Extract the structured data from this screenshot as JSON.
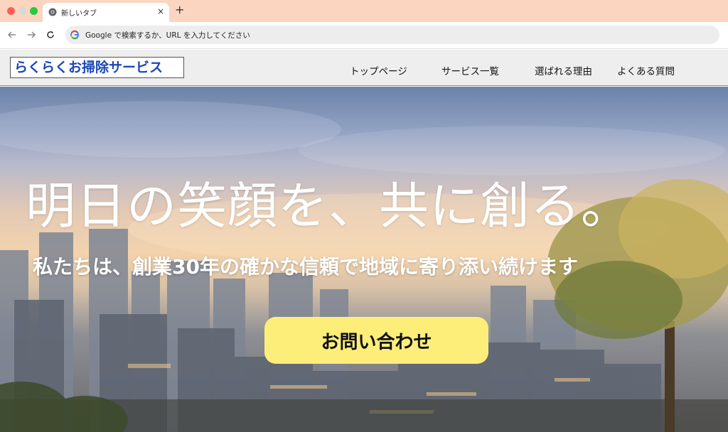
{
  "browser": {
    "tab_title": "新しいタブ",
    "tab_close": "×",
    "new_tab": "+",
    "address": "Google で検索するか、URL を入力してください"
  },
  "site": {
    "logo": "らくらくお掃除サービス",
    "nav": [
      {
        "label": "トップページ"
      },
      {
        "label": "サービス一覧"
      },
      {
        "label": "選ばれる理由"
      },
      {
        "label": "よくある質問"
      }
    ]
  },
  "hero": {
    "title": "明日の笑顔を、共に創る。",
    "subtitle": "私たちは、創業30年の確かな信頼で地域に寄り添い続けます",
    "cta_label": "お問い合わせ"
  },
  "colors": {
    "tabbar": "#fbd5c0",
    "logo_text": "#1a47b8",
    "cta_bg": "#fdee7a"
  }
}
